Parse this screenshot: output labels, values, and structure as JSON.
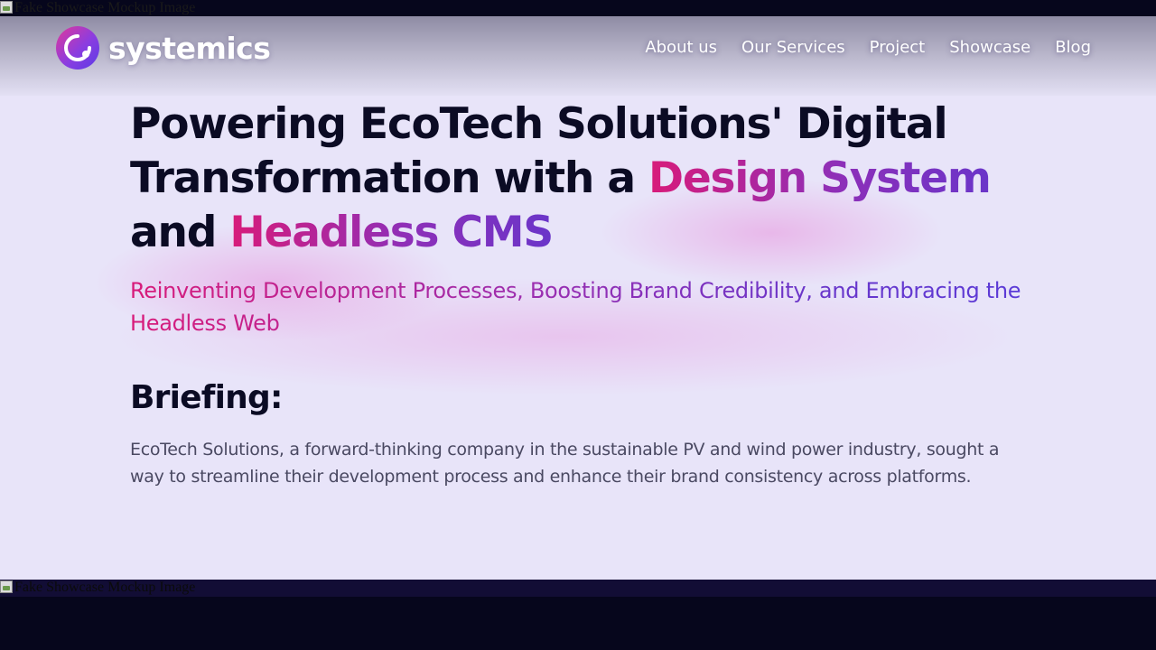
{
  "images": {
    "top_alt": "Fake Showcase Mockup Image",
    "bottom_alt": "Fake Showcase Mockup Image"
  },
  "header": {
    "logo_text": "systemics",
    "nav": [
      "About us",
      "Our Services",
      "Project",
      "Showcase",
      "Blog"
    ]
  },
  "hero": {
    "title_part1": "Powering EcoTech Solutions' Digital Transformation with a ",
    "title_highlight1": "Design System",
    "title_part2": " and ",
    "title_highlight2": "Headless CMS",
    "subtitle": "Reinventing Development Processes, Boosting Brand Credibility, and Embracing the Headless Web"
  },
  "briefing": {
    "heading": "Briefing:",
    "text": "EcoTech Solutions, a forward-thinking company in the sustainable PV and wind power industry, sought a way to streamline their development process and enhance their brand consistency across platforms."
  },
  "colors": {
    "background": "#e8e4f9",
    "dark": "#0b0b24",
    "accent_pink": "#d81b7a",
    "accent_purple": "#6a35c9"
  }
}
